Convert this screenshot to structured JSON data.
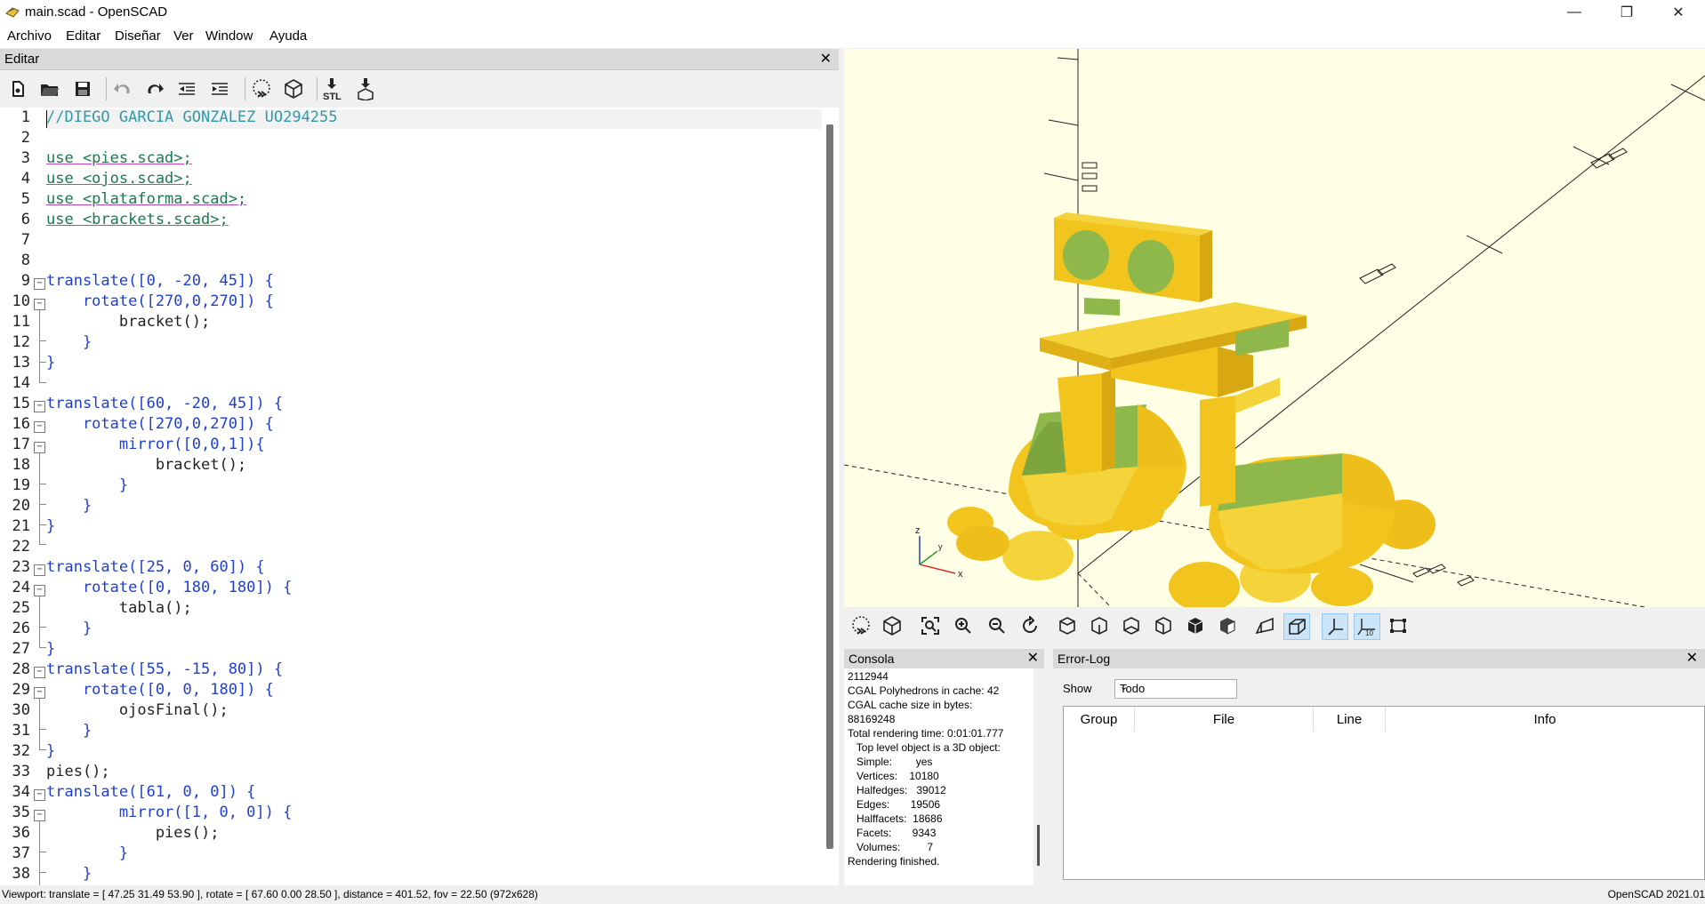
{
  "window": {
    "title": "main.scad - OpenSCAD",
    "minimize": "—",
    "maximize": "❐",
    "close": "✕"
  },
  "menu": [
    "Archivo",
    "Editar",
    "Diseñar",
    "Ver",
    "Window",
    "Ayuda"
  ],
  "editor": {
    "title": "Editar",
    "close": "✕",
    "lines": [
      "//DIEGO GARCIA GONZALEZ UO294255",
      "",
      "use <pies.scad>;",
      "use <ojos.scad>;",
      "use <plataforma.scad>;",
      "use <brackets.scad>;",
      "",
      "",
      "translate([0, -20, 45]) {",
      "    rotate([270,0,270]) {",
      "        bracket();",
      "    }",
      "}",
      "",
      "translate([60, -20, 45]) {",
      "    rotate([270,0,270]) {",
      "        mirror([0,0,1]){",
      "            bracket();",
      "        }",
      "    }",
      "}",
      "",
      "translate([25, 0, 60]) {",
      "    rotate([0, 180, 180]) {",
      "        tabla();",
      "    }",
      "}",
      "translate([55, -15, 80]) {",
      "    rotate([0, 0, 180]) {",
      "        ojosFinal();",
      "    }",
      "}",
      "pies();",
      "translate([61, 0, 0]) {",
      "        mirror([1, 0, 0]) {",
      "            pies();",
      "        }",
      "    }"
    ]
  },
  "viewport": {
    "axis_label_z": "z",
    "axis_label_x": "x",
    "axis_label_y": "y"
  },
  "console": {
    "title": "Consola",
    "close": "✕",
    "lines": [
      "2112944",
      "CGAL Polyhedrons in cache: 42",
      "CGAL cache size in bytes:",
      "88169248",
      "Total rendering time: 0:01:01.777",
      "   Top level object is a 3D object:",
      "   Simple:        yes",
      "   Vertices:    10180",
      "   Halfedges:   39012",
      "   Edges:       19506",
      "   Halffacets:  18686",
      "   Facets:       9343",
      "   Volumes:         7",
      "Rendering finished."
    ]
  },
  "errorlog": {
    "title": "Error-Log",
    "close": "✕",
    "show_label": "Show",
    "show_value": "Todo",
    "columns": [
      "Group",
      "File",
      "Line",
      "Info"
    ]
  },
  "status": {
    "viewport": "Viewport: translate = [ 47.25 31.49 53.90 ], rotate = [ 67.60 0.00 28.50 ], distance = 401.52, fov = 22.50 (972x628)",
    "version": "OpenSCAD 2021.01"
  },
  "colors": {
    "model_yellow": "#f5d630",
    "model_green": "#8fb84a",
    "viewport_bg": "#ffffe5"
  }
}
